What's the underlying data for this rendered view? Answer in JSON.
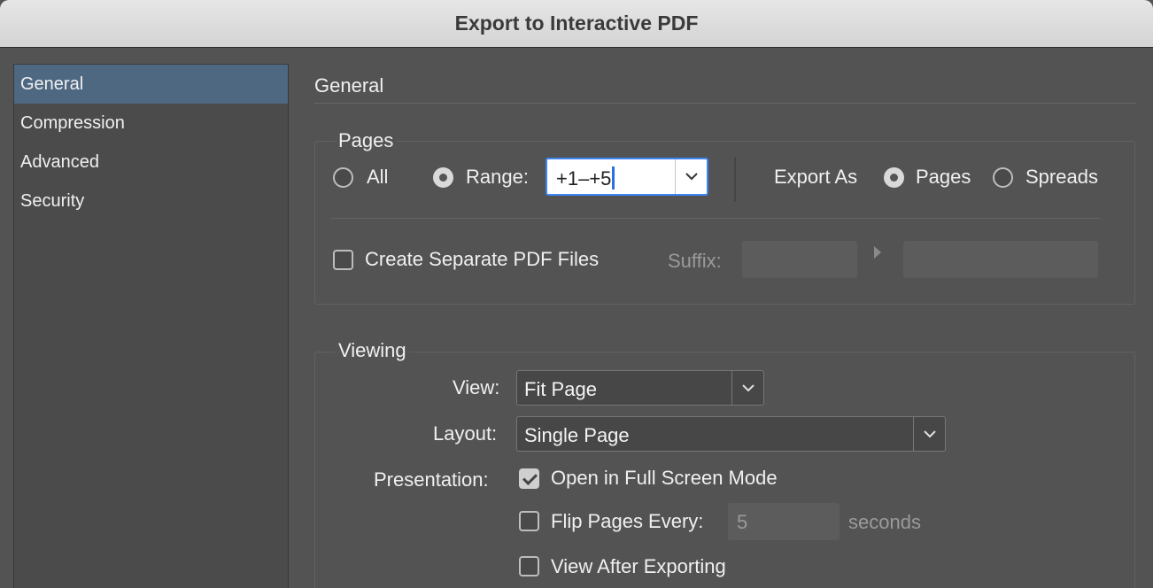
{
  "window": {
    "title": "Export to Interactive PDF"
  },
  "sidebar": {
    "items": [
      {
        "label": "General",
        "selected": true
      },
      {
        "label": "Compression",
        "selected": false
      },
      {
        "label": "Advanced",
        "selected": false
      },
      {
        "label": "Security",
        "selected": false
      }
    ]
  },
  "main": {
    "title": "General"
  },
  "pages": {
    "group_label": "Pages",
    "all_label": "All",
    "range_label": "Range:",
    "range_value": "+1–+5",
    "selected": "Range",
    "export_as_label": "Export As",
    "pages_label": "Pages",
    "spreads_label": "Spreads",
    "export_as_selected": "Pages",
    "separate_pdf_label": "Create Separate PDF Files",
    "separate_pdf_checked": false,
    "suffix_label": "Suffix:",
    "suffix_value": ""
  },
  "viewing": {
    "group_label": "Viewing",
    "view_label": "View:",
    "view_value": "Fit Page",
    "layout_label": "Layout:",
    "layout_value": "Single Page",
    "presentation_label": "Presentation:",
    "full_screen_label": "Open in Full Screen Mode",
    "full_screen_checked": true,
    "flip_label": "Flip Pages Every:",
    "flip_checked": false,
    "flip_value": "5",
    "flip_unit": "seconds",
    "view_after_label": "View After Exporting",
    "view_after_checked": false
  },
  "colors": {
    "accent": "#3d84f5",
    "selection": "#4e6882",
    "background": "#535353"
  }
}
